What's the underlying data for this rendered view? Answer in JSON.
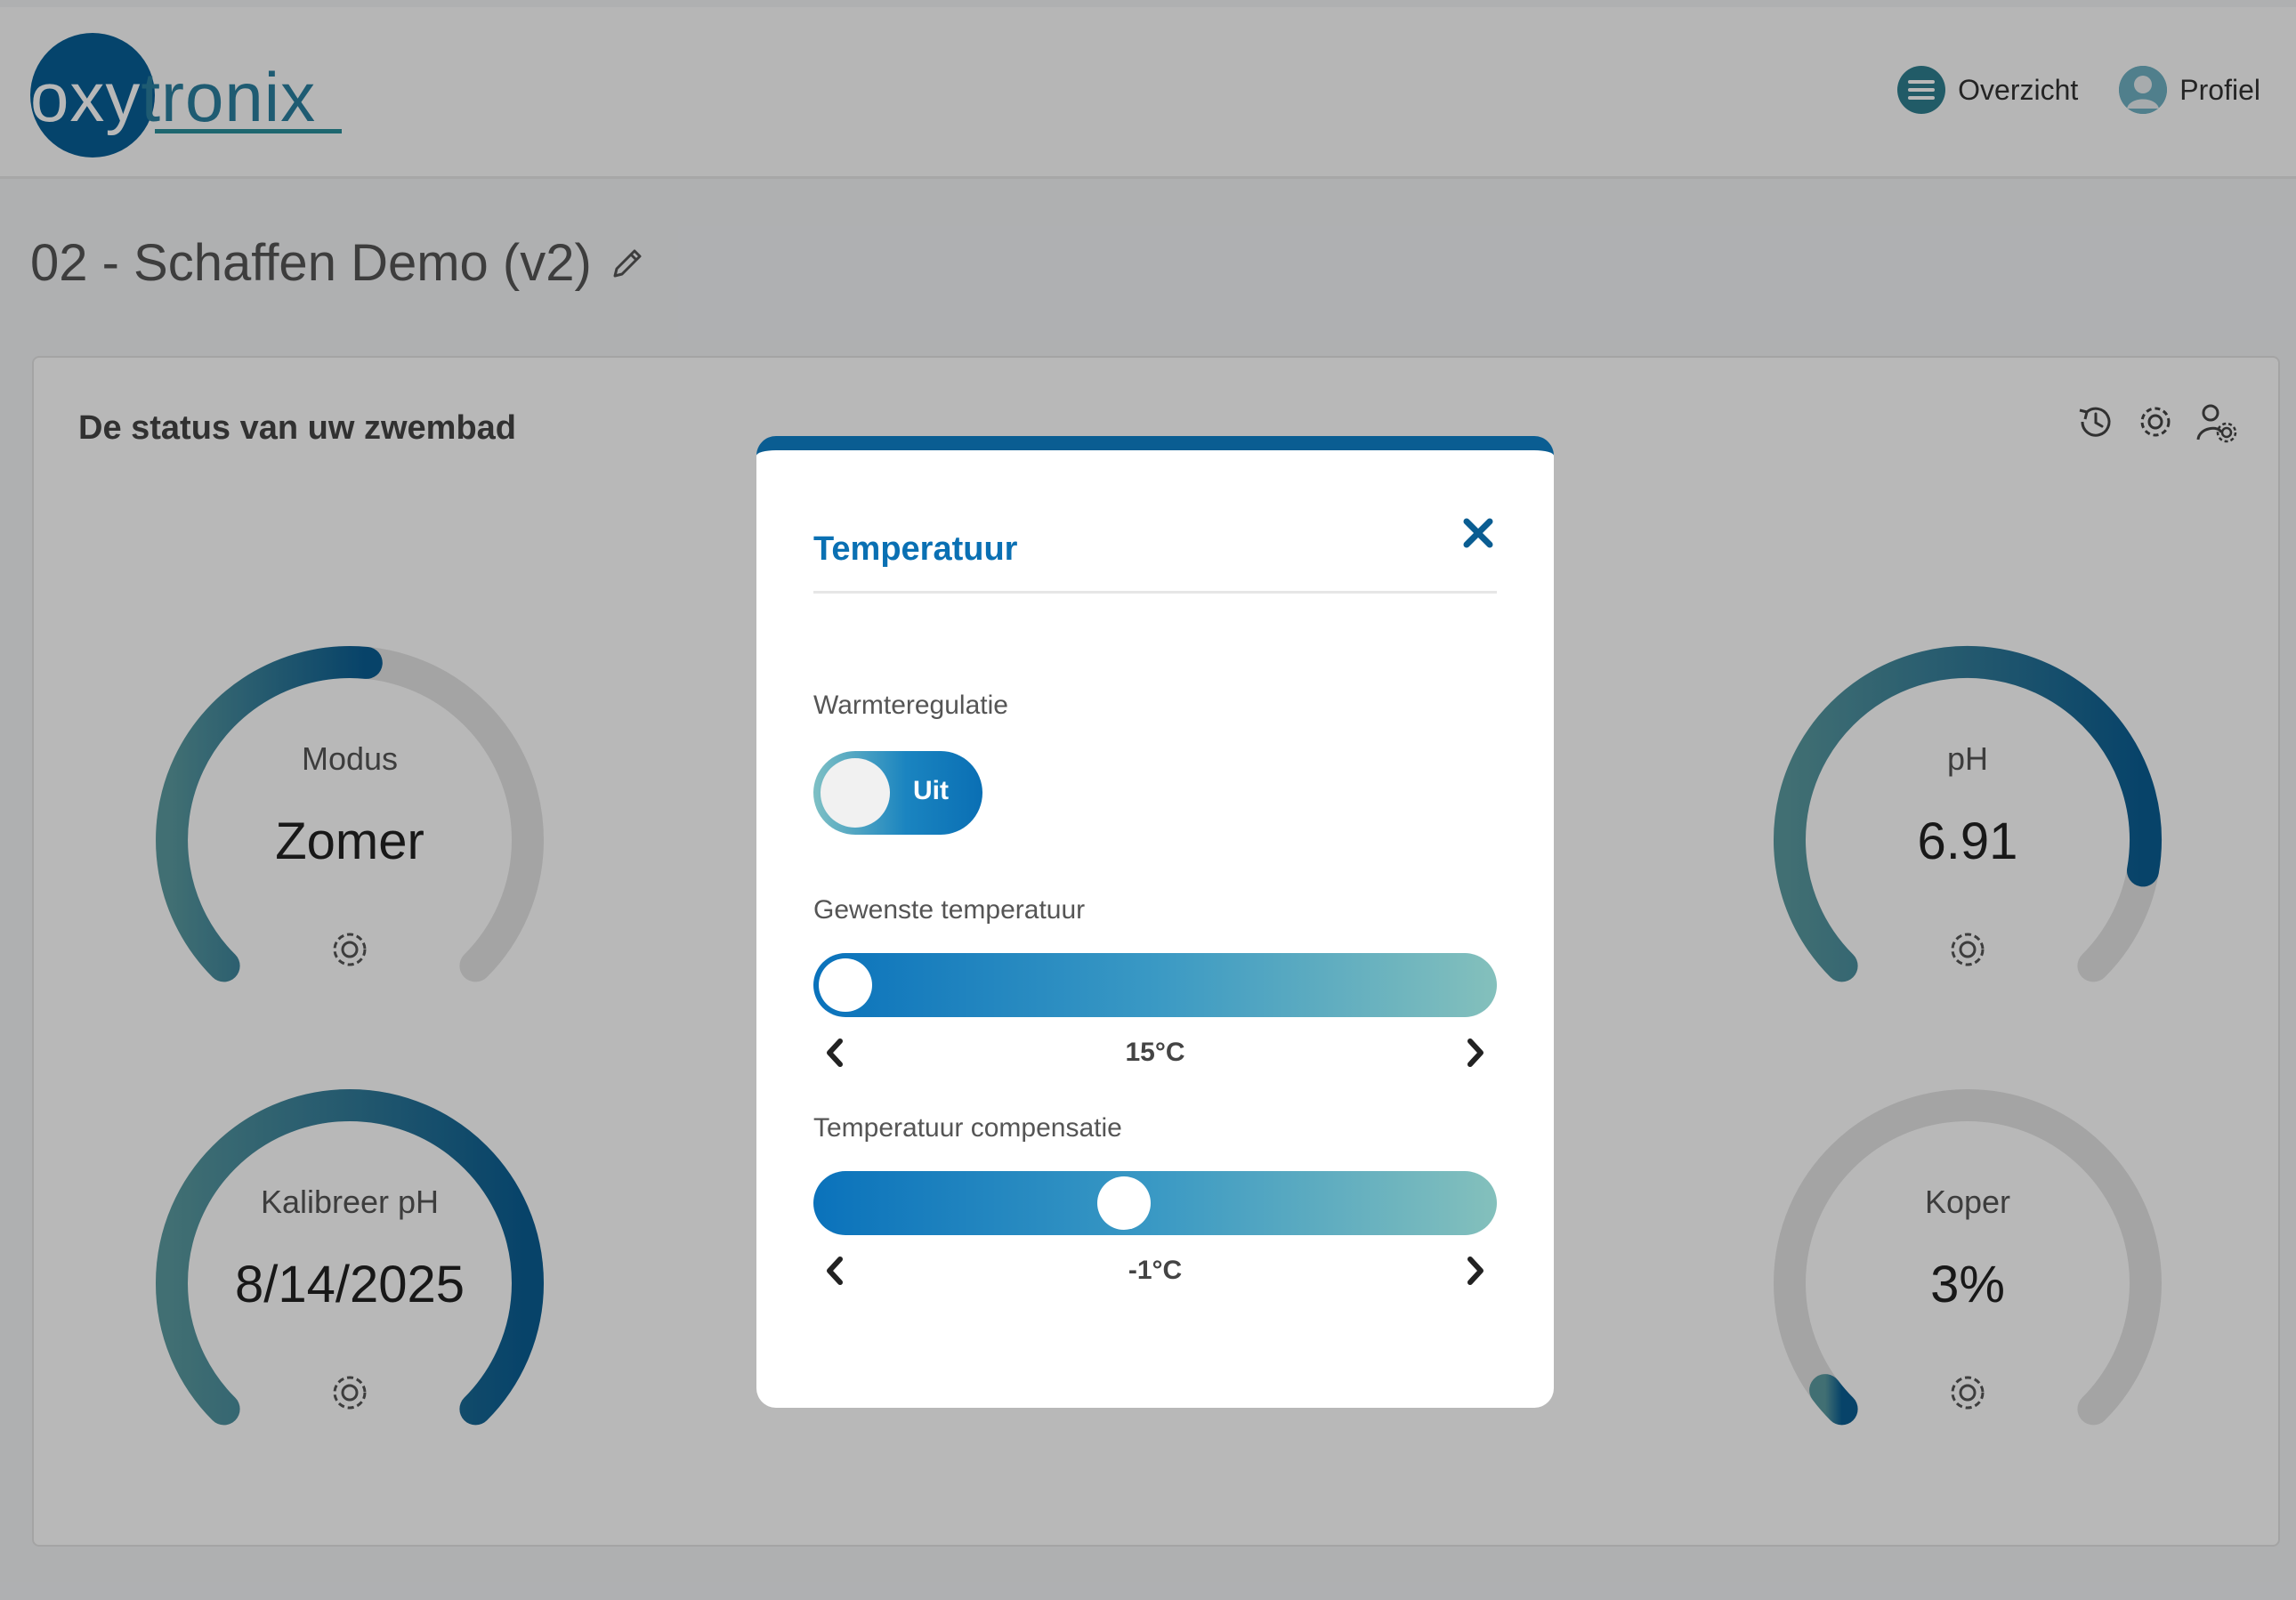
{
  "header": {
    "logo_text": "oxytronix",
    "nav": [
      {
        "label": "Overzicht",
        "icon": "menu-icon"
      },
      {
        "label": "Profiel",
        "icon": "user-avatar-icon"
      }
    ]
  },
  "page": {
    "title": "02 - Schaffen Demo (v2)",
    "edit_icon": "pencil-icon"
  },
  "status_card": {
    "title": "De status van uw zwembad",
    "tools": [
      "history-icon",
      "gear-icon",
      "user-settings-icon"
    ],
    "gauges": [
      {
        "label": "Modus",
        "value": "Zomer",
        "level": 0.52
      },
      {
        "label": "pH",
        "value": "6.91",
        "level": 0.87
      },
      {
        "label": "Kalibreer pH",
        "value": "8/14/2025",
        "level": 1.0
      },
      {
        "label": "Koper",
        "value": "3%",
        "level": 0.03
      }
    ]
  },
  "dialog": {
    "title": "Temperatuur",
    "close_icon": "close-icon",
    "heating": {
      "label": "Warmteregulatie",
      "state": "Uit"
    },
    "desired_temp": {
      "label": "Gewenste temperatuur",
      "value": "15°C",
      "level": 0.0
    },
    "compensation": {
      "label": "Temperatuur compensatie",
      "value": "-1°C",
      "level": 0.45
    }
  },
  "colors": {
    "brand": "#075f96",
    "accent": "#0a70b3",
    "gauge_start": "#5a9aa0",
    "gauge_end": "#0a5d92",
    "gauge_track": "#e4e4e4"
  }
}
